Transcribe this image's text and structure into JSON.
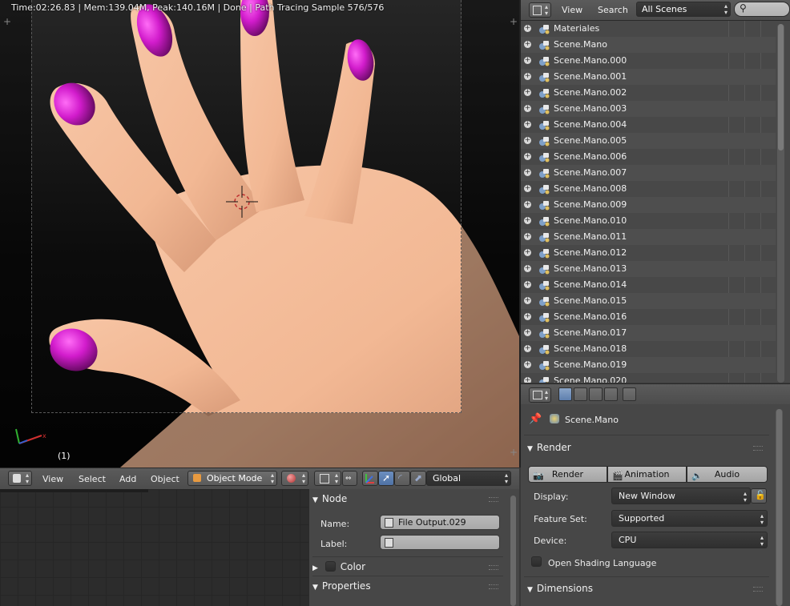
{
  "viewport": {
    "stats": "Time:02:26.83 | Mem:139.04M, Peak:140.16M | Done | Path Tracing Sample 576/576",
    "frame_number": "(1)",
    "colors": {
      "nail": "#cc19c4",
      "skin": "#f2b894"
    }
  },
  "viewport_header": {
    "menus": [
      "View",
      "Select",
      "Add",
      "Object"
    ],
    "mode": "Object Mode",
    "orientation": "Global"
  },
  "node_panel": {
    "section_node": "Node",
    "name_label": "Name:",
    "name_value": "File Output.029",
    "label_label": "Label:",
    "label_value": "",
    "section_color": "Color",
    "section_properties": "Properties"
  },
  "outliner": {
    "menus": [
      "View",
      "Search"
    ],
    "scene_filter": "All Scenes",
    "items": [
      "Materiales",
      "Scene.Mano",
      "Scene.Mano.000",
      "Scene.Mano.001",
      "Scene.Mano.002",
      "Scene.Mano.003",
      "Scene.Mano.004",
      "Scene.Mano.005",
      "Scene.Mano.006",
      "Scene.Mano.007",
      "Scene.Mano.008",
      "Scene.Mano.009",
      "Scene.Mano.010",
      "Scene.Mano.011",
      "Scene.Mano.012",
      "Scene.Mano.013",
      "Scene.Mano.014",
      "Scene.Mano.015",
      "Scene.Mano.016",
      "Scene.Mano.017",
      "Scene.Mano.018",
      "Scene.Mano.019",
      "Scene.Mano.020"
    ]
  },
  "properties": {
    "context_scene": "Scene.Mano",
    "render_section": "Render",
    "buttons": [
      "Render",
      "Animation",
      "Audio"
    ],
    "display_label": "Display:",
    "display_value": "New Window",
    "feature_set_label": "Feature Set:",
    "feature_set_value": "Supported",
    "device_label": "Device:",
    "device_value": "CPU",
    "osl_label": "Open Shading Language",
    "osl_checked": false,
    "dimensions_section": "Dimensions"
  }
}
